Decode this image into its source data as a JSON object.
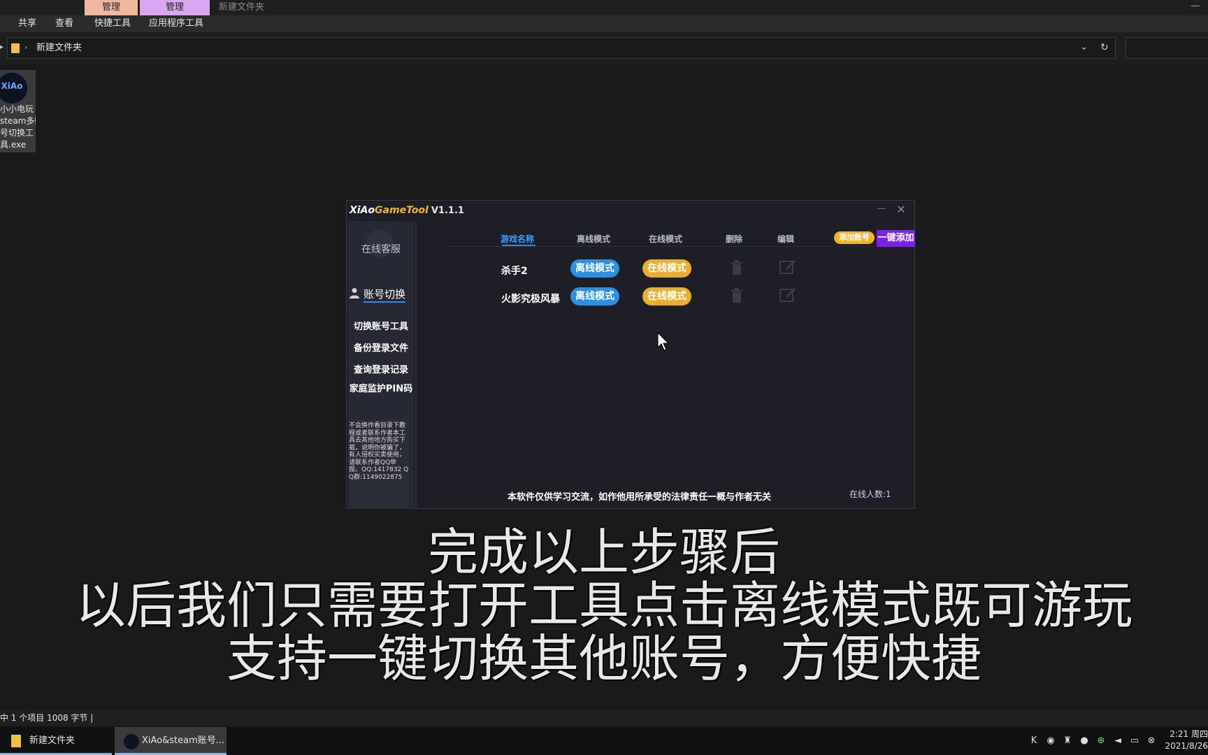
{
  "explorer": {
    "ribbon": {
      "contextual_tabs": [
        "管理",
        "管理"
      ],
      "window_title": "新建文件夹",
      "menu": [
        "共享",
        "查看",
        "快捷工具",
        "应用程序工具"
      ]
    },
    "address": {
      "path": "新建文件夹"
    },
    "file": {
      "name": "小小电玩\nsteam多账\n号切换工\n具.exe",
      "icon_text": "XiAo"
    },
    "status": "中 1 个项目   1008 字节   |"
  },
  "tool": {
    "title_a": "XiAo",
    "title_b": "GameTool",
    "version": "V1.1.1",
    "sidebar": {
      "support": "在线客服",
      "active": "账号切换",
      "items": [
        "切换账号工具",
        "备份登录文件",
        "查询登录记录",
        "家庭监护PIN码"
      ],
      "note": "不会换作看目录下教程或者联系作者本工具去其他地方购买下载，说明你被骗了，有人侵权买卖使用，请联系作者QQ举报。QQ:1417832   QQ群:1149022875"
    },
    "columns": [
      "游戏名称",
      "离线模式",
      "在线模式",
      "删除",
      "编辑"
    ],
    "add_account": "添加账号",
    "one_key_add": "一键添加",
    "rows": [
      {
        "name": "杀手2",
        "offline": "离线模式",
        "online": "在线模式"
      },
      {
        "name": "火影究极风暴",
        "offline": "离线模式",
        "online": "在线模式"
      }
    ],
    "disclaimer": "本软件仅供学习交流，如作他用所承受的法律责任一概与作者无关",
    "online_count": "在线人数:1"
  },
  "subtitles": [
    "完成以上步骤后",
    "以后我们只需要打开工具点击离线模式既可游玩",
    "支持一键切换其他账号，方便快捷"
  ],
  "taskbar": {
    "items": [
      "新建文件夹",
      "XiAo&steam账号..."
    ],
    "time": "2:21 周四",
    "date": "2021/8/26"
  },
  "colors": {
    "offline": "#2d8fe0",
    "online": "#e8b02e",
    "onekey": "#7a22e6",
    "accent": "#2e8ae6"
  }
}
